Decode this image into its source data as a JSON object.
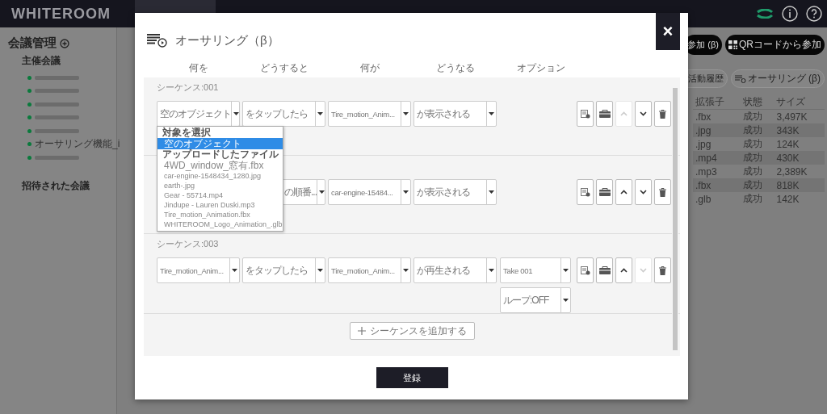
{
  "app": {
    "logo": "WHITEROOM"
  },
  "sidebar": {
    "title": "会議管理",
    "sections": [
      {
        "title": "主催会議",
        "items": [
          {
            "kind": "blurred"
          },
          {
            "kind": "blurred"
          },
          {
            "kind": "blurred"
          },
          {
            "kind": "blurred"
          },
          {
            "kind": "blurred"
          },
          {
            "kind": "text",
            "label": "オーサリング機能_i"
          },
          {
            "kind": "blurred"
          }
        ]
      },
      {
        "title": "招待された会議"
      }
    ]
  },
  "toolbar": {
    "buttons": [
      {
        "label": "参加 (β)",
        "kind": "join"
      },
      {
        "label": "QRコードから参加",
        "kind": "qr"
      }
    ],
    "secondary": [
      {
        "label": "活動履歴",
        "kind": "history"
      },
      {
        "label": "オーサリング (β)",
        "kind": "authoring"
      }
    ]
  },
  "file_table": {
    "columns": [
      "拡張子",
      "状態",
      "サイズ"
    ],
    "rows": [
      [
        ".fbx",
        "成功",
        "3,497K"
      ],
      [
        ".jpg",
        "成功",
        "343K"
      ],
      [
        ".jpg",
        "成功",
        "124K"
      ],
      [
        ".mp4",
        "成功",
        "430K"
      ],
      [
        ".mp3",
        "成功",
        "2,389K"
      ],
      [
        ".fbx",
        "成功",
        "818K"
      ],
      [
        ".glb",
        "成功",
        "142K"
      ]
    ]
  },
  "modal": {
    "title": "オーサリング（β）",
    "close": "×",
    "columns": [
      "何を",
      "どうすると",
      "何が",
      "どうなる",
      "オプション"
    ],
    "sequences": [
      {
        "label": "シーケンス:001",
        "up_disabled": true,
        "down_disabled": false,
        "fields": [
          {
            "value": "空のオブジェクト",
            "menu": [
              {
                "label": "対象を選択",
                "items": [
                  {
                    "label": "空のオブジェクト",
                    "selected": true
                  }
                ]
              },
              {
                "label": "アップロードしたファイル",
                "items": [
                  {
                    "label": "4WD_window_窓有.fbx",
                    "selected": false
                  },
                  {
                    "label": "car-engine-1548434_1280.jpg",
                    "selected": false
                  },
                  {
                    "label": "earth-.jpg",
                    "selected": false
                  },
                  {
                    "label": "Gear - 55714.mp4",
                    "selected": false
                  },
                  {
                    "label": "Jindupe - Lauren Duski.mp3",
                    "selected": false
                  },
                  {
                    "label": "Tire_motion_Animation.fbx",
                    "selected": false
                  },
                  {
                    "label": "WHITEROOM_Logo_Animation_.glb",
                    "selected": false
                  }
                ]
              }
            ]
          },
          {
            "value": "をタップしたら"
          },
          {
            "value": "Tire_motion_Anim..."
          },
          {
            "value": "が表示される"
          }
        ]
      },
      {
        "up_disabled": false,
        "down_disabled": false,
        "fields": [
          {
            "value": "の順番...",
            "covered": true
          },
          {
            "value": "car-engine-15484..."
          },
          {
            "value": "が表示される"
          }
        ]
      },
      {
        "label": "シーケンス:003",
        "up_disabled": false,
        "down_disabled": true,
        "fields": [
          {
            "value": "Tire_motion_Anim..."
          },
          {
            "value": "をタップしたら"
          },
          {
            "value": "Tire_motion_Anim..."
          },
          {
            "value": "が再生される"
          }
        ],
        "options": [
          "Take 001",
          "ループ:OFF"
        ]
      }
    ],
    "add_button": "シーケンスを追加する",
    "submit": "登録"
  }
}
